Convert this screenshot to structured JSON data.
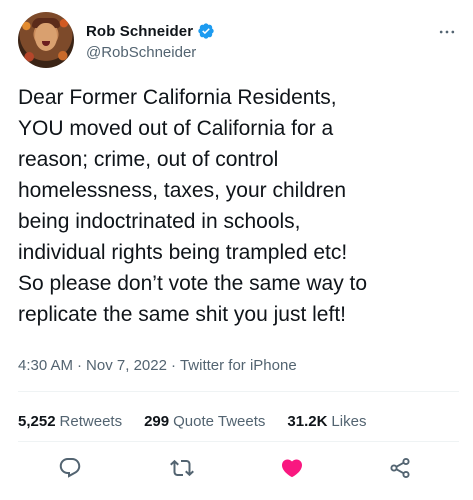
{
  "author": {
    "display_name": "Rob Schneider",
    "handle": "@RobSchneider",
    "verified": true
  },
  "tweet": {
    "text": "Dear Former California Residents,\nYOU moved out of California for a\nreason; crime, out of control\nhomelessness, taxes, your children\nbeing indoctrinated in schools,\nindividual rights being trampled etc!\nSo please don’t vote the same way to\nreplicate the same shit you just left!",
    "time": "4:30 AM",
    "date": "Nov 7, 2022",
    "source": "Twitter for iPhone",
    "separator": "·"
  },
  "stats": {
    "retweets_count": "5,252",
    "retweets_label": "Retweets",
    "quotes_count": "299",
    "quotes_label": "Quote Tweets",
    "likes_count": "31.2K",
    "likes_label": "Likes"
  },
  "icons": {
    "verified": "verified-badge-icon",
    "more": "more-options-icon",
    "reply": "reply-icon",
    "retweet": "retweet-icon",
    "like": "heart-icon",
    "share": "share-icon"
  },
  "colors": {
    "text": "#0f1419",
    "muted": "#536471",
    "verified_blue": "#1d9bf0",
    "like_pink": "#f91880",
    "divider": "#eff3f4"
  }
}
